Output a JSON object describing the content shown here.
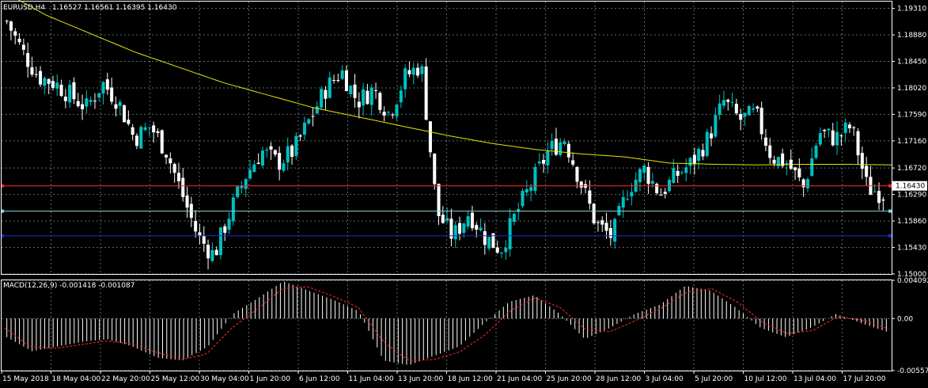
{
  "header": {
    "symbol": "EURUSD,H4",
    "ohlc": "1.16527 1.16561 1.16395 1.16430"
  },
  "macd_header": "MACD(12,26,9) -0.001418 -0.001087",
  "colors": {
    "background": "#000000",
    "grid": "#5a6a6a",
    "bull_candle": "#00c0c0",
    "bear_candle": "#ffffff",
    "ma_line": "#e6e600",
    "current_price_line": "#ff2a2a",
    "line_aqua": "#7fd7d7",
    "line_blue": "#1e2bd6",
    "macd_signal": "#ff2a2a",
    "macd_hist": "#ffffff"
  },
  "chart_data": [
    {
      "type": "candlestick",
      "title": "EURUSD,H4",
      "y_ticks": [
        "1.19310",
        "1.18880",
        "1.18450",
        "1.18020",
        "1.17590",
        "1.17160",
        "1.16720",
        "1.16290",
        "1.15860",
        "1.15430",
        "1.15000"
      ],
      "ylim": [
        1.15,
        1.1942
      ],
      "current_price": "1.16430",
      "horizontal_levels": [
        1.1643,
        1.1602,
        1.1562
      ],
      "x_ticks": [
        "15 May 2018",
        "18 May 04:00",
        "22 May 20:00",
        "25 May 12:00",
        "30 May 04:00",
        "1 Jun 20:00",
        "6 Jun 12:00",
        "11 Jun 04:00",
        "13 Jun 20:00",
        "18 Jun 12:00",
        "21 Jun 04:00",
        "25 Jun 20:00",
        "28 Jun 12:00",
        "3 Jul 04:00",
        "5 Jul 20:00",
        "10 Jul 12:00",
        "13 Jul 04:00",
        "17 Jul 20:00"
      ],
      "close_path": [
        1.191,
        1.186,
        1.182,
        1.181,
        1.179,
        1.177,
        1.181,
        1.178,
        1.172,
        1.174,
        1.17,
        1.163,
        1.156,
        1.153,
        1.16,
        1.166,
        1.17,
        1.168,
        1.17,
        1.175,
        1.18,
        1.183,
        1.178,
        1.18,
        1.176,
        1.182,
        1.184,
        1.16,
        1.156,
        1.16,
        1.156,
        1.154,
        1.16,
        1.165,
        1.17,
        1.172,
        1.165,
        1.158,
        1.156,
        1.164,
        1.167,
        1.163,
        1.166,
        1.168,
        1.172,
        1.178,
        1.175,
        1.176,
        1.169,
        1.168,
        1.164,
        1.173,
        1.172,
        1.174,
        1.164,
        1.163
      ],
      "moving_average": [
        1.196,
        1.192,
        1.189,
        1.186,
        1.1835,
        1.181,
        1.179,
        1.177,
        1.1755,
        1.174,
        1.1725,
        1.1712,
        1.1702,
        1.1695,
        1.169,
        1.168,
        1.1678,
        1.1677,
        1.1678,
        1.1678,
        1.1677
      ]
    },
    {
      "type": "histogram",
      "title": "MACD(12,26,9)",
      "y_ticks": [
        "0.004092",
        "0.00",
        "-0.005576"
      ],
      "ylim": [
        -0.005576,
        0.004092
      ],
      "macd_path": [
        -0.002,
        -0.0035,
        -0.003,
        -0.0025,
        -0.0022,
        -0.003,
        -0.0042,
        -0.0045,
        -0.003,
        0.0005,
        0.0022,
        0.004,
        0.003,
        0.002,
        0.0008,
        -0.0045,
        -0.005,
        -0.004,
        -0.003,
        -0.0005,
        0.0018,
        0.0025,
        0.0005,
        -0.0022,
        -0.001,
        0.0005,
        0.0015,
        0.0035,
        0.003,
        0.0012,
        -0.001,
        -0.002,
        -0.001,
        0.0005,
        -0.0005,
        -0.0014
      ],
      "signal_path": [
        -0.001,
        -0.003,
        -0.0032,
        -0.0028,
        -0.0024,
        -0.0027,
        -0.0036,
        -0.0044,
        -0.0038,
        -0.001,
        0.001,
        0.0032,
        0.0034,
        0.0024,
        0.0012,
        -0.0025,
        -0.0045,
        -0.0044,
        -0.0036,
        -0.0018,
        0.0008,
        0.0022,
        0.0012,
        -0.0012,
        -0.0014,
        -0.0002,
        0.0011,
        0.0028,
        0.0032,
        0.0018,
        -0.0004,
        -0.0016,
        -0.0013,
        0.0002,
        -0.0002,
        -0.0011
      ]
    }
  ]
}
